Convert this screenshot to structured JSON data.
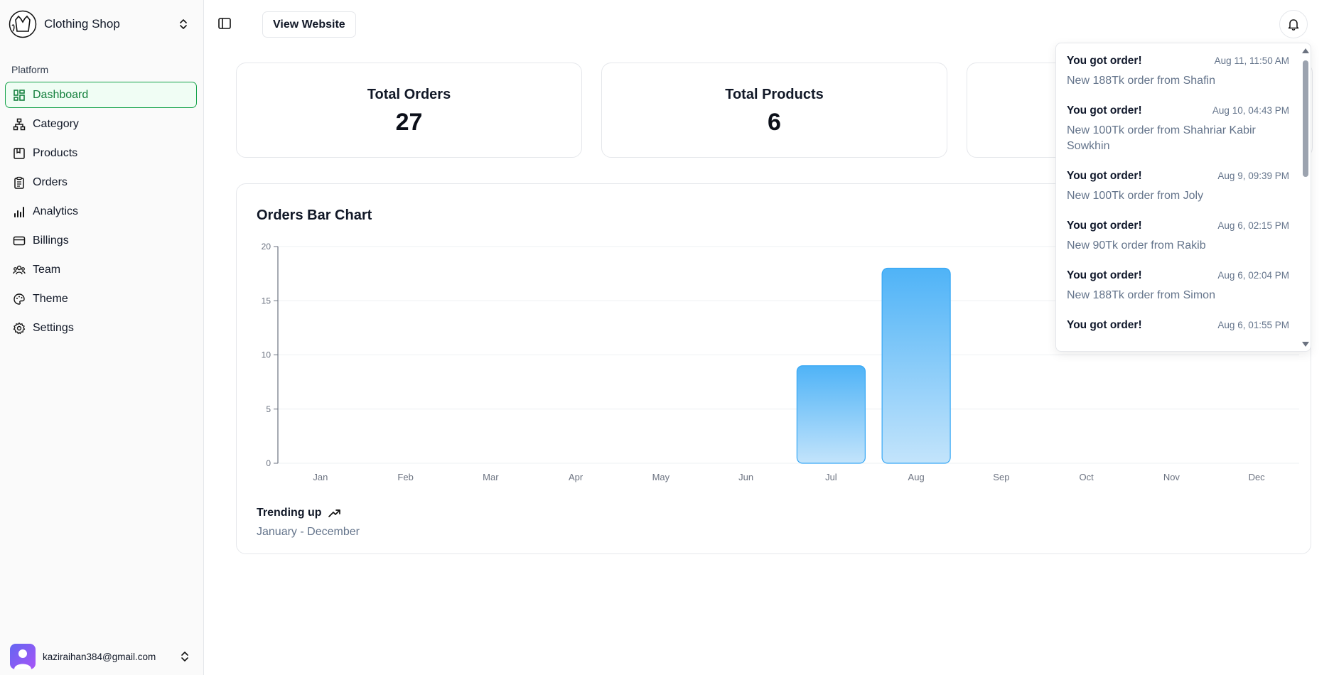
{
  "brand": {
    "name": "Clothing Shop"
  },
  "sidebar": {
    "section_label": "Platform",
    "items": [
      {
        "label": "Dashboard",
        "icon": "dashboard-icon",
        "active": true
      },
      {
        "label": "Category",
        "icon": "hierarchy-icon"
      },
      {
        "label": "Products",
        "icon": "product-box-icon"
      },
      {
        "label": "Orders",
        "icon": "clipboard-icon"
      },
      {
        "label": "Analytics",
        "icon": "bar-chart-icon"
      },
      {
        "label": "Billings",
        "icon": "credit-card-icon"
      },
      {
        "label": "Team",
        "icon": "team-icon"
      },
      {
        "label": "Theme",
        "icon": "palette-icon"
      },
      {
        "label": "Settings",
        "icon": "gear-icon"
      }
    ],
    "user_email": "kaziraihan384@gmail.com"
  },
  "header": {
    "view_website": "View Website"
  },
  "stats": [
    {
      "label": "Total Orders",
      "value": "27"
    },
    {
      "label": "Total Products",
      "value": "6"
    }
  ],
  "chart": {
    "title": "Orders Bar Chart",
    "trend": "Trending up",
    "range": "January - December"
  },
  "chart_data": {
    "type": "bar",
    "title": "Orders Bar Chart",
    "categories": [
      "Jan",
      "Feb",
      "Mar",
      "Apr",
      "May",
      "Jun",
      "Jul",
      "Aug",
      "Sep",
      "Oct",
      "Nov",
      "Dec"
    ],
    "values": [
      0,
      0,
      0,
      0,
      0,
      0,
      9,
      18,
      0,
      0,
      0,
      0
    ],
    "yticks": [
      0,
      5,
      10,
      15,
      20
    ],
    "ylim": [
      0,
      20
    ],
    "grid": true,
    "bar_color": "#4fb3f7"
  },
  "notifications": [
    {
      "title": "You got order!",
      "time": "Aug 11, 11:50 AM",
      "message": "New 188Tk order from Shafin"
    },
    {
      "title": "You got order!",
      "time": "Aug 10, 04:43 PM",
      "message": "New 100Tk order from Shahriar Kabir Sowkhin"
    },
    {
      "title": "You got order!",
      "time": "Aug 9, 09:39 PM",
      "message": "New 100Tk order from Joly"
    },
    {
      "title": "You got order!",
      "time": "Aug 6, 02:15 PM",
      "message": "New 90Tk order from Rakib"
    },
    {
      "title": "You got order!",
      "time": "Aug 6, 02:04 PM",
      "message": "New 188Tk order from Simon"
    },
    {
      "title": "You got order!",
      "time": "Aug 6, 01:55 PM",
      "message": ""
    }
  ]
}
